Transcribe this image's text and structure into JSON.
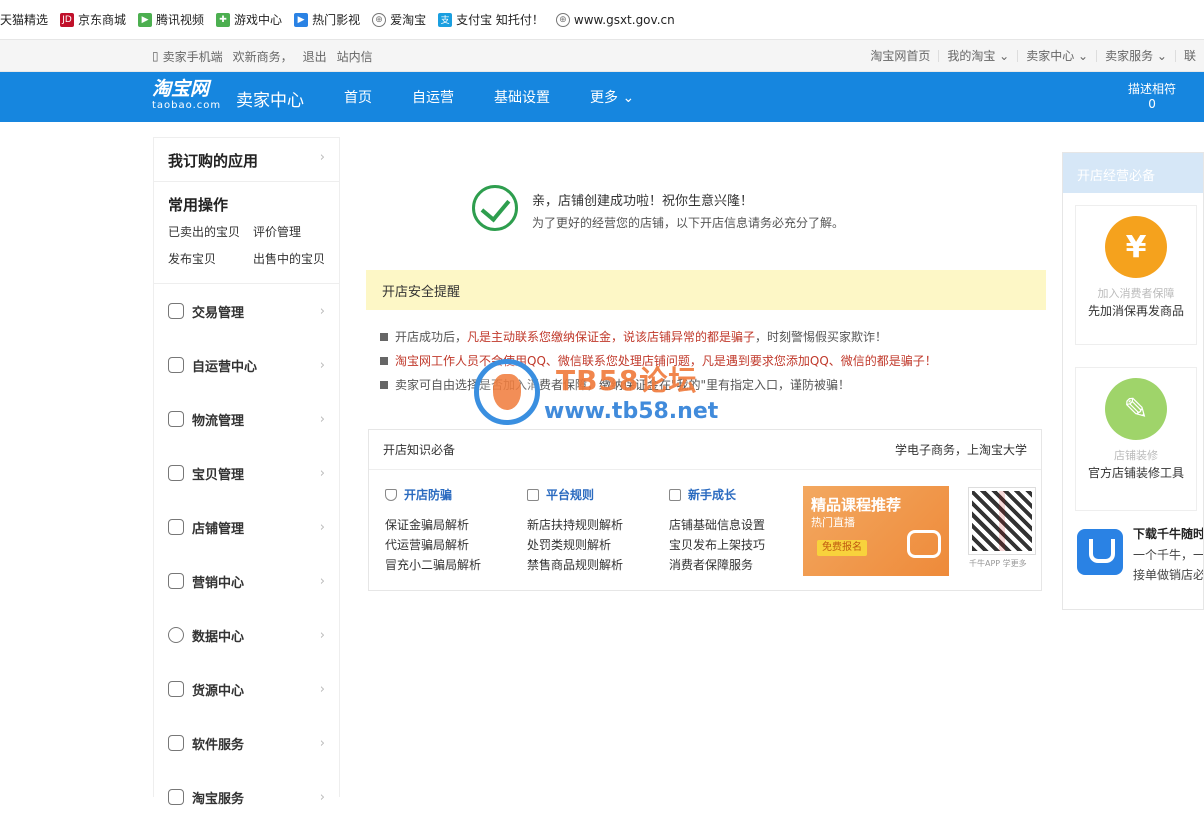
{
  "bookmarks": [
    {
      "label": "天猫精选",
      "icon": "tmall-icon",
      "color": "#c40000"
    },
    {
      "label": "京东商城",
      "icon": "jd-icon",
      "color": "#c0102a"
    },
    {
      "label": "腾讯视频",
      "icon": "tencent-video-icon",
      "color": "#4caf50"
    },
    {
      "label": "游戏中心",
      "icon": "gamepad-icon",
      "color": "#4caf50"
    },
    {
      "label": "热门影视",
      "icon": "play-icon",
      "color": "#2a82e4"
    },
    {
      "label": "爱淘宝",
      "icon": "globe-icon",
      "color": "#777777"
    },
    {
      "label": "支付宝 知托付！",
      "icon": "alipay-icon",
      "color": "#1a9fe0"
    },
    {
      "label": "www.gsxt.gov.cn",
      "icon": "globe-icon",
      "color": "#777777"
    }
  ],
  "topbar": {
    "left": [
      "卖家手机端",
      "欢新商务，",
      "退出",
      "站内信"
    ],
    "right": [
      "淘宝网首页",
      "我的淘宝 ⌄",
      "卖家中心 ⌄",
      "卖家服务 ⌄",
      "联"
    ]
  },
  "nav": {
    "logo_cn": "淘宝网",
    "logo_en": "taobao.com",
    "title": "卖家中心",
    "menu": [
      "首页",
      "自运营",
      "基础设置",
      "更多 ⌄"
    ],
    "right_label": "描述相符",
    "right_value": "0"
  },
  "sidebar": {
    "apps_title": "我订购的应用",
    "common_title": "常用操作",
    "common_links": [
      "已卖出的宝贝",
      "评价管理",
      "发布宝贝",
      "出售中的宝贝"
    ],
    "items": [
      {
        "label": "交易管理",
        "icon": "trade-icon"
      },
      {
        "label": "自运营中心",
        "icon": "chat-icon"
      },
      {
        "label": "物流管理",
        "icon": "truck-icon"
      },
      {
        "label": "宝贝管理",
        "icon": "bag-icon"
      },
      {
        "label": "店铺管理",
        "icon": "store-icon"
      },
      {
        "label": "营销中心",
        "icon": "megaphone-icon"
      },
      {
        "label": "数据中心",
        "icon": "compass-icon"
      },
      {
        "label": "货源中心",
        "icon": "box-icon"
      },
      {
        "label": "软件服务",
        "icon": "grid-icon"
      },
      {
        "label": "淘宝服务",
        "icon": "service-icon"
      }
    ]
  },
  "success": {
    "title": "亲，店铺创建成功啦！祝你生意兴隆！",
    "subtitle": "为了更好的经营您的店铺，以下开店信息请务必充分了解。"
  },
  "alert": {
    "title": "开店安全提醒",
    "items": [
      {
        "pre": "开店成功后，",
        "red": "凡是主动联系您缴纳保证金，说该店铺异常的都是骗子",
        "post": "，时刻警惕假买家欺诈！"
      },
      {
        "pre": "",
        "red": "淘宝网工作人员不会使用QQ、微信联系您处理店铺问题，凡是遇到要求您添加QQ、微信的都是骗子！",
        "post": ""
      },
      {
        "pre": "卖家可自由选择是否加入消费者保障，缴纳保证金在\"我的\"里有指定入口，谨防被骗！",
        "red": "",
        "post": ""
      }
    ]
  },
  "watermark": {
    "line1": "TB58论坛",
    "line2": "www.tb58.net"
  },
  "knowledge": {
    "title": "开店知识必备",
    "right": "学电子商务，上淘宝大学",
    "columns": [
      {
        "title": "开店防骗",
        "icon": "shield-icon",
        "links": [
          "保证金骗局解析",
          "代运营骗局解析",
          "冒充小二骗局解析"
        ]
      },
      {
        "title": "平台规则",
        "icon": "document-icon",
        "links": [
          "新店扶持规则解析",
          "处罚类规则解析",
          "禁售商品规则解析"
        ]
      },
      {
        "title": "新手成长",
        "icon": "growth-icon",
        "links": [
          "店铺基础信息设置",
          "宝贝发布上架技巧",
          "消费者保障服务"
        ]
      }
    ],
    "promo": {
      "title": "精品课程推荐",
      "subtitle": "热门直播",
      "button": "免费报名"
    },
    "qr_caption": "千牛APP 学更多"
  },
  "right_panel": {
    "title": "开店经营必备",
    "card1": {
      "icon": "yuan-icon",
      "symbol": "¥",
      "light": "加入消费者保障",
      "text": "先加消保再发商品",
      "color": "#f5a21d"
    },
    "card2": {
      "icon": "brush-icon",
      "light": "店铺装修",
      "text": "官方店铺装修工具",
      "color": "#9fd46a"
    },
    "download": {
      "title": "下载千牛随时",
      "text": "一个千牛，一架，接单做销店必备！"
    }
  }
}
